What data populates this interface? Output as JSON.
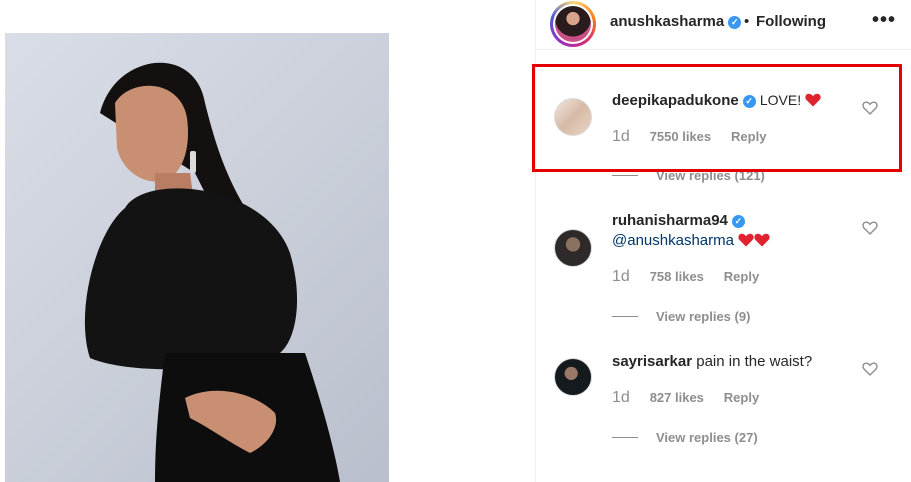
{
  "post": {
    "author": "anushkasharma",
    "separator": "•",
    "follow_label": "Following",
    "more_label": "•••"
  },
  "comments": [
    {
      "user": "deepikapadukone",
      "verified": true,
      "text": "LOVE!",
      "hearts": 1,
      "time": "1d",
      "likes": "7550 likes",
      "reply": "Reply",
      "view_replies": "View replies (121)",
      "highlighted": true
    },
    {
      "user": "ruhanisharma94",
      "verified": true,
      "mention": "@anushkasharma",
      "hearts": 2,
      "time": "1d",
      "likes": "758 likes",
      "reply": "Reply",
      "view_replies": "View replies (9)"
    },
    {
      "user": "sayrisarkar",
      "verified": false,
      "text": "pain in the waist?",
      "time": "1d",
      "likes": "827 likes",
      "reply": "Reply",
      "view_replies": "View replies (27)"
    }
  ],
  "colors": {
    "highlight_border": "#e50000",
    "verified_badge": "#3897f0",
    "mention": "#003569",
    "heart": "#e0242f"
  }
}
